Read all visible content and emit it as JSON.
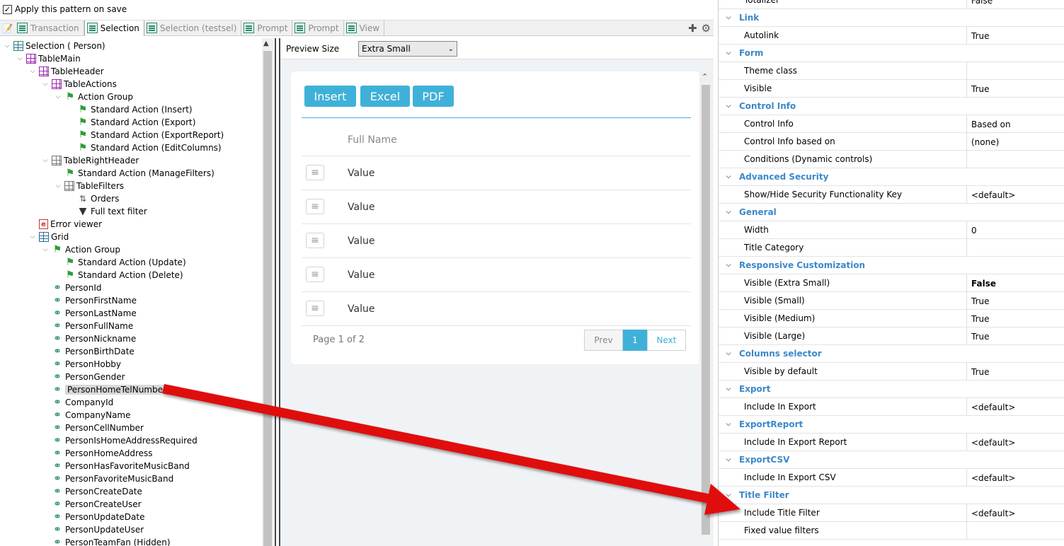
{
  "topbar": {
    "checkbox_label": "Apply this pattern on save",
    "checked": true
  },
  "tabs": [
    {
      "label": "Transaction",
      "active": false
    },
    {
      "label": "Selection",
      "active": true
    },
    {
      "label": "Selection (testsel)",
      "active": false
    },
    {
      "label": "Prompt",
      "active": false
    },
    {
      "label": "Prompt",
      "active": false
    },
    {
      "label": "View",
      "active": false
    }
  ],
  "tree": [
    {
      "label": "Selection ( Person)",
      "depth": 0,
      "icon": "grid-icon",
      "expanded": true
    },
    {
      "label": "TableMain",
      "depth": 1,
      "icon": "table-icon",
      "expanded": true
    },
    {
      "label": "TableHeader",
      "depth": 2,
      "icon": "table-icon",
      "expanded": true
    },
    {
      "label": "TableActions",
      "depth": 3,
      "icon": "table-icon",
      "expanded": true
    },
    {
      "label": "Action Group",
      "depth": 4,
      "icon": "flag-icon",
      "expanded": true
    },
    {
      "label": "Standard Action (Insert)",
      "depth": 5,
      "icon": "flag-icon"
    },
    {
      "label": "Standard Action (Export)",
      "depth": 5,
      "icon": "flag-icon"
    },
    {
      "label": "Standard Action (ExportReport)",
      "depth": 5,
      "icon": "flag-icon"
    },
    {
      "label": "Standard Action (EditColumns)",
      "depth": 5,
      "icon": "flag-icon"
    },
    {
      "label": "TableRightHeader",
      "depth": 3,
      "icon": "gray-table-icon",
      "expanded": true
    },
    {
      "label": "Standard Action (ManageFilters)",
      "depth": 4,
      "icon": "flag-icon"
    },
    {
      "label": "TableFilters",
      "depth": 4,
      "icon": "gray-table-icon",
      "expanded": true
    },
    {
      "label": "Orders",
      "depth": 5,
      "icon": "orders-icon"
    },
    {
      "label": "Full text filter",
      "depth": 5,
      "icon": "filter-icon"
    },
    {
      "label": "Error viewer",
      "depth": 2,
      "icon": "error-viewer-icon"
    },
    {
      "label": "Grid",
      "depth": 2,
      "icon": "data-grid-icon",
      "expanded": true
    },
    {
      "label": "Action Group",
      "depth": 3,
      "icon": "flag-icon",
      "expanded": true
    },
    {
      "label": "Standard Action (Update)",
      "depth": 4,
      "icon": "flag-icon"
    },
    {
      "label": "Standard Action (Delete)",
      "depth": 4,
      "icon": "flag-icon"
    },
    {
      "label": "PersonId",
      "depth": 3,
      "icon": "attribute-icon"
    },
    {
      "label": "PersonFirstName",
      "depth": 3,
      "icon": "attribute-icon"
    },
    {
      "label": "PersonLastName",
      "depth": 3,
      "icon": "attribute-icon"
    },
    {
      "label": "PersonFullName",
      "depth": 3,
      "icon": "attribute-icon"
    },
    {
      "label": "PersonNickname",
      "depth": 3,
      "icon": "attribute-icon"
    },
    {
      "label": "PersonBirthDate",
      "depth": 3,
      "icon": "attribute-icon"
    },
    {
      "label": "PersonHobby",
      "depth": 3,
      "icon": "attribute-icon"
    },
    {
      "label": "PersonGender",
      "depth": 3,
      "icon": "attribute-icon"
    },
    {
      "label": "PersonHomeTelNumber",
      "depth": 3,
      "icon": "attribute-icon",
      "selected": true
    },
    {
      "label": "CompanyId",
      "depth": 3,
      "icon": "attribute-icon"
    },
    {
      "label": "CompanyName",
      "depth": 3,
      "icon": "attribute-icon"
    },
    {
      "label": "PersonCellNumber",
      "depth": 3,
      "icon": "attribute-icon"
    },
    {
      "label": "PersonIsHomeAddressRequired",
      "depth": 3,
      "icon": "attribute-icon"
    },
    {
      "label": "PersonHomeAddress",
      "depth": 3,
      "icon": "attribute-icon"
    },
    {
      "label": "PersonHasFavoriteMusicBand",
      "depth": 3,
      "icon": "attribute-icon"
    },
    {
      "label": "PersonFavoriteMusicBand",
      "depth": 3,
      "icon": "attribute-icon"
    },
    {
      "label": "PersonCreateDate",
      "depth": 3,
      "icon": "attribute-icon"
    },
    {
      "label": "PersonCreateUser",
      "depth": 3,
      "icon": "attribute-icon"
    },
    {
      "label": "PersonUpdateDate",
      "depth": 3,
      "icon": "attribute-icon"
    },
    {
      "label": "PersonUpdateUser",
      "depth": 3,
      "icon": "attribute-icon"
    },
    {
      "label": "PersonTeamFan (Hidden)",
      "depth": 3,
      "icon": "attribute-icon"
    }
  ],
  "preview": {
    "size_label": "Preview Size",
    "size_value": "Extra Small",
    "buttons": [
      "Insert",
      "Excel",
      "PDF"
    ],
    "column_header": "Full Name",
    "rows": [
      "Value",
      "Value",
      "Value",
      "Value",
      "Value"
    ],
    "page_text": "Page 1 of 2",
    "pager": {
      "prev": "Prev",
      "current": "1",
      "next": "Next"
    },
    "accent": "#3fb1d8"
  },
  "properties": [
    {
      "type": "row",
      "name": "Totalizer",
      "value": "False"
    },
    {
      "type": "cat",
      "name": "Link"
    },
    {
      "type": "row",
      "name": "Autolink",
      "value": "True"
    },
    {
      "type": "cat",
      "name": "Form"
    },
    {
      "type": "row",
      "name": "Theme class",
      "value": ""
    },
    {
      "type": "row",
      "name": "Visible",
      "value": "True"
    },
    {
      "type": "cat",
      "name": "Control Info"
    },
    {
      "type": "row",
      "name": "Control Info",
      "value": "Based on"
    },
    {
      "type": "row",
      "name": "Control Info based on",
      "value": "(none)"
    },
    {
      "type": "row",
      "name": "Conditions (Dynamic controls)",
      "value": ""
    },
    {
      "type": "cat",
      "name": "Advanced Security"
    },
    {
      "type": "row",
      "name": "Show/Hide Security Functionality Key",
      "value": "<default>"
    },
    {
      "type": "cat",
      "name": "General"
    },
    {
      "type": "row",
      "name": "Width",
      "value": "0"
    },
    {
      "type": "row",
      "name": "Title Category",
      "value": ""
    },
    {
      "type": "cat",
      "name": "Responsive Customization"
    },
    {
      "type": "row",
      "name": "Visible (Extra Small)",
      "value": "False",
      "bold": true
    },
    {
      "type": "row",
      "name": "Visible (Small)",
      "value": "True"
    },
    {
      "type": "row",
      "name": "Visible (Medium)",
      "value": "True"
    },
    {
      "type": "row",
      "name": "Visible (Large)",
      "value": "True"
    },
    {
      "type": "cat",
      "name": "Columns selector"
    },
    {
      "type": "row",
      "name": "Visible by default",
      "value": "True"
    },
    {
      "type": "cat",
      "name": "Export"
    },
    {
      "type": "row",
      "name": "Include In Export",
      "value": "<default>"
    },
    {
      "type": "cat",
      "name": "ExportReport"
    },
    {
      "type": "row",
      "name": "Include In Export Report",
      "value": "<default>"
    },
    {
      "type": "cat",
      "name": "ExportCSV"
    },
    {
      "type": "row",
      "name": "Include In Export CSV",
      "value": "<default>"
    },
    {
      "type": "cat",
      "name": "Title Filter"
    },
    {
      "type": "row",
      "name": "Include Title Filter",
      "value": "<default>"
    },
    {
      "type": "row",
      "name": "Fixed value filters",
      "value": ""
    }
  ],
  "colors": {
    "category_text": "#3c88c9",
    "arrow": "#e01010",
    "selection_bg": "#d9d9d9"
  }
}
